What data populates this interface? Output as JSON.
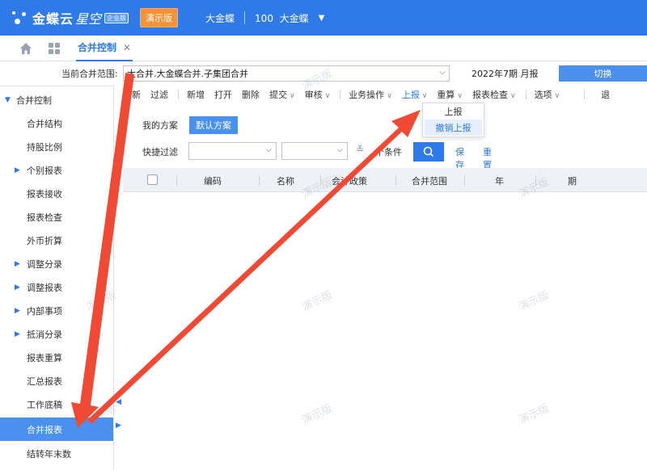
{
  "header": {
    "brand": "金蝶云",
    "brand_suffix": "星空",
    "edition": "企业版",
    "demo_badge": "演示版",
    "org_name": "大金蝶",
    "account_code": "100",
    "account_name": "大金蝶"
  },
  "tabs": [
    {
      "label": "合并控制",
      "close": "✕"
    }
  ],
  "scope": {
    "label": "当前合并范围:",
    "value": "大合并.大金蝶合并.子集团合并",
    "period": "2022年7期  月报",
    "switch_label": "切换"
  },
  "sidebar": {
    "root": "合并控制",
    "items": [
      {
        "label": "合并结构",
        "expandable": false
      },
      {
        "label": "持股比例",
        "expandable": false
      },
      {
        "label": "个别报表",
        "expandable": true
      },
      {
        "label": "报表接收",
        "expandable": false
      },
      {
        "label": "报表检查",
        "expandable": false
      },
      {
        "label": "外币折算",
        "expandable": false
      },
      {
        "label": "调整分录",
        "expandable": true
      },
      {
        "label": "调整报表",
        "expandable": true
      },
      {
        "label": "内部事项",
        "expandable": true
      },
      {
        "label": "抵消分录",
        "expandable": true
      },
      {
        "label": "报表重算",
        "expandable": false
      },
      {
        "label": "汇总报表",
        "expandable": false
      },
      {
        "label": "工作底稿",
        "expandable": false
      },
      {
        "label": "合并报表",
        "expandable": false,
        "active": true
      },
      {
        "label": "结转年末数",
        "expandable": false
      }
    ]
  },
  "toolbar": {
    "refresh": "刷新",
    "filter": "过滤",
    "add": "新增",
    "open": "打开",
    "delete": "删除",
    "submit": "提交",
    "audit": "审核",
    "business_ops": "业务操作",
    "report_up": "上报",
    "recalc": "重算",
    "report_check": "报表检查",
    "options": "选项",
    "exit": "退"
  },
  "dropdown": {
    "items": [
      "上报",
      "撤销上报"
    ],
    "highlighted_index": 1
  },
  "scheme": {
    "label": "我的方案",
    "default": "默认方案"
  },
  "filter": {
    "label": "快捷过滤",
    "condition": "个条件",
    "save": "保存",
    "reset": "重置"
  },
  "table": {
    "columns": [
      "编码",
      "名称",
      "会计政策",
      "合并范围",
      "年",
      "期"
    ]
  },
  "watermark": "演示版",
  "colors": {
    "brand_blue": "#2e7ae8",
    "demo_orange": "#f7923a",
    "annotation_red": "#f04a34"
  }
}
